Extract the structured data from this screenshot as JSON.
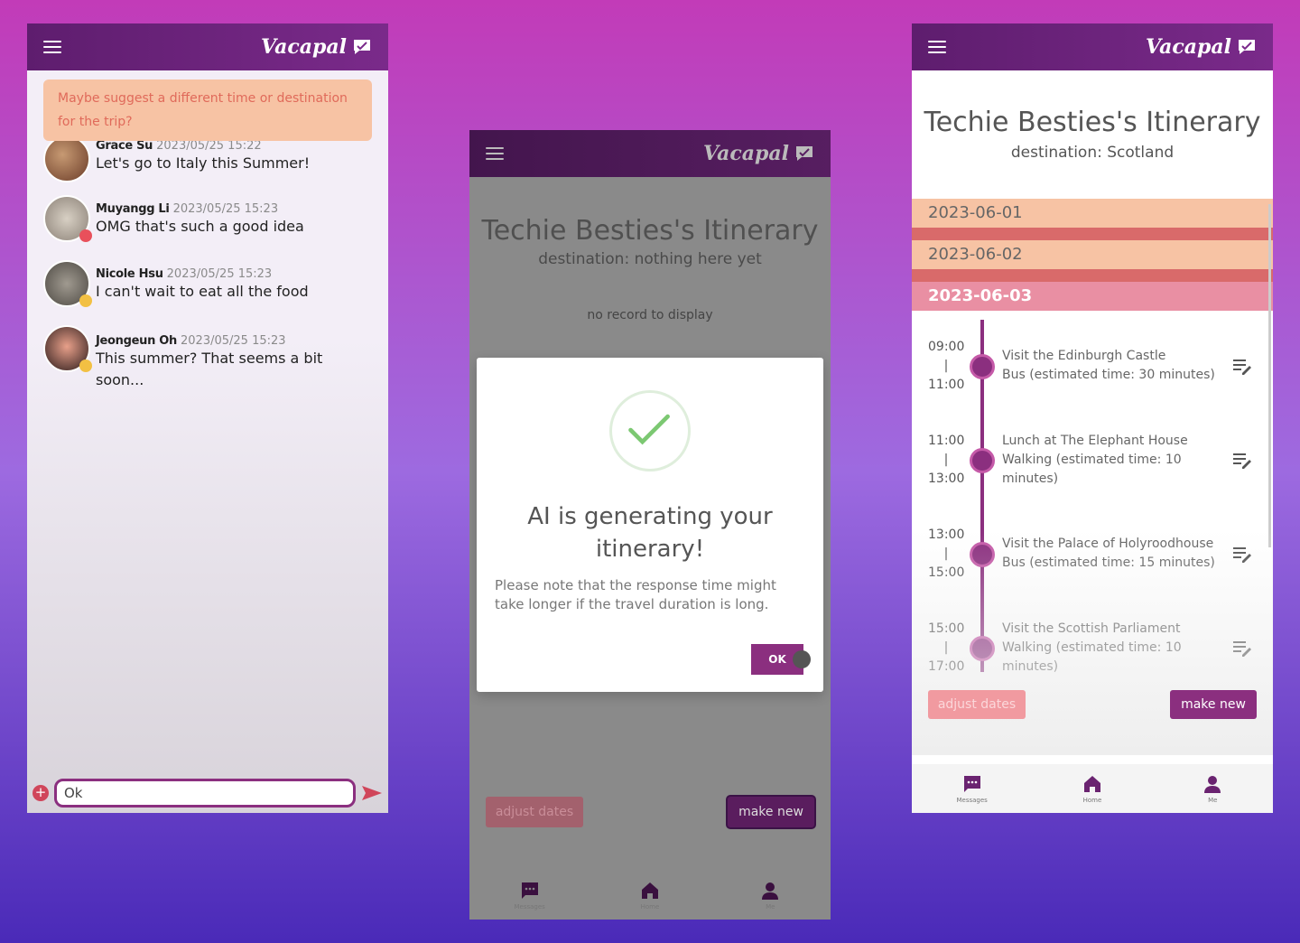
{
  "brand": {
    "name": "Vacapal"
  },
  "chat": {
    "suggestion": "Maybe suggest a different time or destination for the trip?",
    "messages": [
      {
        "author": "Grace Su",
        "time": "2023/05/25 15:22",
        "text": "Let's go to Italy this Summer!"
      },
      {
        "author": "Muyangg Li",
        "time": "2023/05/25 15:23",
        "text": "OMG that's such a good idea"
      },
      {
        "author": "Nicole Hsu",
        "time": "2023/05/25 15:23",
        "text": "I can't wait to eat all the food"
      },
      {
        "author": "Jeongeun Oh",
        "time": "2023/05/25 15:23",
        "text": "This summer? That seems a bit soon..."
      }
    ],
    "input_value": "Ok"
  },
  "loading": {
    "title": "Techie Besties's Itinerary",
    "destination": "destination: nothing here yet",
    "no_record": "no record to display",
    "modal_title": "AI is generating your itinerary!",
    "modal_note": "Please note that the response time might take longer if the travel duration is long.",
    "ok_label": "OK",
    "adjust_label": "adjust dates",
    "make_label": "make new"
  },
  "itinerary": {
    "title": "Techie Besties's Itinerary",
    "destination": "destination: Scotland",
    "dates": [
      "2023-06-01",
      "2023-06-02",
      "2023-06-03"
    ],
    "items": [
      {
        "start": "09:00",
        "sep": "|",
        "end": "11:00",
        "title": "Visit the Edinburgh Castle",
        "transport": "Bus (estimated time: 30 minutes)"
      },
      {
        "start": "11:00",
        "sep": "|",
        "end": "13:00",
        "title": "Lunch at The Elephant House",
        "transport": "Walking (estimated time: 10 minutes)"
      },
      {
        "start": "13:00",
        "sep": "|",
        "end": "15:00",
        "title": "Visit the Palace of Holyroodhouse",
        "transport": "Bus (estimated time: 15 minutes)"
      },
      {
        "start": "15:00",
        "sep": "|",
        "end": "17:00",
        "title": "Visit the Scottish Parliament",
        "transport": "Walking (estimated time: 10 minutes)"
      }
    ],
    "adjust_label": "adjust dates",
    "make_label": "make new"
  },
  "nav": {
    "messages": "Messages",
    "home": "Home",
    "me": "Me"
  },
  "colors": {
    "primary": "#8b2f7f",
    "date_band": "#f7c3a4",
    "date_active": "#e98fa3",
    "suggestion": "#f7c3a4"
  }
}
